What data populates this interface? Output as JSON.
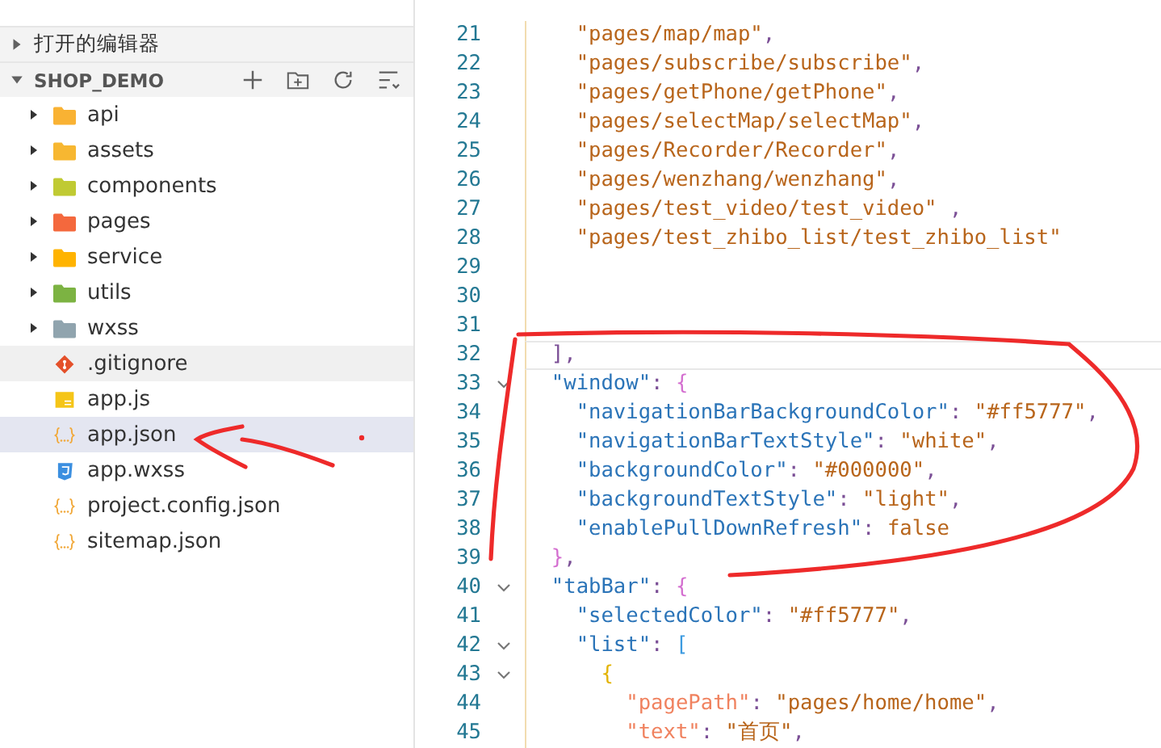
{
  "sidebar": {
    "sections": [
      {
        "title": "打开的编辑器",
        "expanded": false,
        "bold": false
      },
      {
        "title": "SHOP_DEMO",
        "expanded": true,
        "bold": true
      }
    ],
    "items": [
      {
        "label": "api",
        "kind": "folder",
        "color": "#f9b233",
        "expanded": false,
        "selected": false,
        "hovered": false
      },
      {
        "label": "assets",
        "kind": "folder",
        "color": "#f7b731",
        "expanded": false,
        "selected": false,
        "hovered": false
      },
      {
        "label": "components",
        "kind": "folder",
        "color": "#c0ca33",
        "expanded": false,
        "selected": false,
        "hovered": false
      },
      {
        "label": "pages",
        "kind": "folder",
        "color": "#f4683d",
        "expanded": false,
        "selected": false,
        "hovered": false
      },
      {
        "label": "service",
        "kind": "folder",
        "color": "#ffb300",
        "expanded": false,
        "selected": false,
        "hovered": false
      },
      {
        "label": "utils",
        "kind": "folder",
        "color": "#7cb342",
        "expanded": false,
        "selected": false,
        "hovered": false
      },
      {
        "label": "wxss",
        "kind": "folder",
        "color": "#90a4ae",
        "expanded": false,
        "selected": false,
        "hovered": false
      },
      {
        "label": ".gitignore",
        "kind": "git",
        "selected": false,
        "hovered": true
      },
      {
        "label": "app.js",
        "kind": "js",
        "selected": false,
        "hovered": false
      },
      {
        "label": "app.json",
        "kind": "json",
        "selected": true,
        "hovered": false
      },
      {
        "label": "app.wxss",
        "kind": "css",
        "selected": false,
        "hovered": false
      },
      {
        "label": "project.config.json",
        "kind": "json",
        "selected": false,
        "hovered": false
      },
      {
        "label": "sitemap.json",
        "kind": "json",
        "selected": false,
        "hovered": false
      }
    ]
  },
  "editor": {
    "lines": [
      {
        "number": "21",
        "fold": false,
        "current": false,
        "segments": [
          {
            "text": "    \"pages/map/map\"",
            "kind": "string"
          },
          {
            "text": ",",
            "kind": "punct"
          }
        ]
      },
      {
        "number": "22",
        "fold": false,
        "current": false,
        "segments": [
          {
            "text": "    \"pages/subscribe/subscribe\"",
            "kind": "string"
          },
          {
            "text": ",",
            "kind": "punct"
          }
        ]
      },
      {
        "number": "23",
        "fold": false,
        "current": false,
        "segments": [
          {
            "text": "    \"pages/getPhone/getPhone\"",
            "kind": "string"
          },
          {
            "text": ",",
            "kind": "punct"
          }
        ]
      },
      {
        "number": "24",
        "fold": false,
        "current": false,
        "segments": [
          {
            "text": "    \"pages/selectMap/selectMap\"",
            "kind": "string"
          },
          {
            "text": ",",
            "kind": "punct"
          }
        ]
      },
      {
        "number": "25",
        "fold": false,
        "current": false,
        "segments": [
          {
            "text": "    \"pages/Recorder/Recorder\"",
            "kind": "string"
          },
          {
            "text": ",",
            "kind": "punct"
          }
        ]
      },
      {
        "number": "26",
        "fold": false,
        "current": false,
        "segments": [
          {
            "text": "    \"pages/wenzhang/wenzhang\"",
            "kind": "string"
          },
          {
            "text": ",",
            "kind": "punct"
          }
        ]
      },
      {
        "number": "27",
        "fold": false,
        "current": false,
        "segments": [
          {
            "text": "    \"pages/test_video/test_video\"",
            "kind": "string"
          },
          {
            "text": " ,",
            "kind": "punct"
          }
        ]
      },
      {
        "number": "28",
        "fold": false,
        "current": false,
        "segments": [
          {
            "text": "    \"pages/test_zhibo_list/test_zhibo_list\"",
            "kind": "string"
          }
        ]
      },
      {
        "number": "29",
        "fold": false,
        "current": false
      },
      {
        "number": "30",
        "fold": false,
        "current": false
      },
      {
        "number": "31",
        "fold": false,
        "current": false
      },
      {
        "number": "32",
        "fold": false,
        "current": true,
        "segments": [
          {
            "text": "  ]",
            "kind": "brace1"
          },
          {
            "text": ",",
            "kind": "punct"
          }
        ]
      },
      {
        "number": "33",
        "fold": true,
        "current": false,
        "segments": [
          {
            "text": "  \"window\"",
            "kind": "key"
          },
          {
            "text": ": ",
            "kind": "punct"
          },
          {
            "text": "{",
            "kind": "brace2"
          }
        ]
      },
      {
        "number": "34",
        "fold": false,
        "current": false,
        "segments": [
          {
            "text": "    \"navigationBarBackgroundColor\"",
            "kind": "key"
          },
          {
            "text": ": ",
            "kind": "punct"
          },
          {
            "text": "\"#ff5777\"",
            "kind": "string"
          },
          {
            "text": ",",
            "kind": "punct"
          }
        ]
      },
      {
        "number": "35",
        "fold": false,
        "current": false,
        "segments": [
          {
            "text": "    \"navigationBarTextStyle\"",
            "kind": "key"
          },
          {
            "text": ": ",
            "kind": "punct"
          },
          {
            "text": "\"white\"",
            "kind": "string"
          },
          {
            "text": ",",
            "kind": "punct"
          }
        ]
      },
      {
        "number": "36",
        "fold": false,
        "current": false,
        "segments": [
          {
            "text": "    \"backgroundColor\"",
            "kind": "key"
          },
          {
            "text": ": ",
            "kind": "punct"
          },
          {
            "text": "\"#000000\"",
            "kind": "string"
          },
          {
            "text": ",",
            "kind": "punct"
          }
        ]
      },
      {
        "number": "37",
        "fold": false,
        "current": false,
        "segments": [
          {
            "text": "    \"backgroundTextStyle\"",
            "kind": "key"
          },
          {
            "text": ": ",
            "kind": "punct"
          },
          {
            "text": "\"light\"",
            "kind": "string"
          },
          {
            "text": ",",
            "kind": "punct"
          }
        ]
      },
      {
        "number": "38",
        "fold": false,
        "current": false,
        "segments": [
          {
            "text": "    \"enablePullDownRefresh\"",
            "kind": "key"
          },
          {
            "text": ": ",
            "kind": "punct"
          },
          {
            "text": "false",
            "kind": "literal"
          }
        ]
      },
      {
        "number": "39",
        "fold": false,
        "current": false,
        "segments": [
          {
            "text": "  }",
            "kind": "brace2"
          },
          {
            "text": ",",
            "kind": "punct"
          }
        ]
      },
      {
        "number": "40",
        "fold": true,
        "current": false,
        "segments": [
          {
            "text": "  \"tabBar\"",
            "kind": "key"
          },
          {
            "text": ": ",
            "kind": "punct"
          },
          {
            "text": "{",
            "kind": "brace2"
          }
        ]
      },
      {
        "number": "41",
        "fold": false,
        "current": false,
        "segments": [
          {
            "text": "    \"selectedColor\"",
            "kind": "key"
          },
          {
            "text": ": ",
            "kind": "punct"
          },
          {
            "text": "\"#ff5777\"",
            "kind": "string"
          },
          {
            "text": ",",
            "kind": "punct"
          }
        ]
      },
      {
        "number": "42",
        "fold": true,
        "current": false,
        "segments": [
          {
            "text": "    \"list\"",
            "kind": "key"
          },
          {
            "text": ": ",
            "kind": "punct"
          },
          {
            "text": "[",
            "kind": "brace3"
          }
        ]
      },
      {
        "number": "43",
        "fold": true,
        "current": false,
        "segments": [
          {
            "text": "      {",
            "kind": "brace4"
          }
        ]
      },
      {
        "number": "44",
        "fold": false,
        "current": false,
        "segments": [
          {
            "text": "        \"pagePath\"",
            "kind": "subkey"
          },
          {
            "text": ": ",
            "kind": "punct"
          },
          {
            "text": "\"pages/home/home\"",
            "kind": "string"
          },
          {
            "text": ",",
            "kind": "punct"
          }
        ]
      },
      {
        "number": "45",
        "fold": false,
        "current": false,
        "segments": [
          {
            "text": "        \"text\"",
            "kind": "subkey"
          },
          {
            "text": ": ",
            "kind": "punct"
          },
          {
            "text": "\"首页\"",
            "kind": "string"
          },
          {
            "text": ",",
            "kind": "punct"
          }
        ]
      }
    ]
  }
}
